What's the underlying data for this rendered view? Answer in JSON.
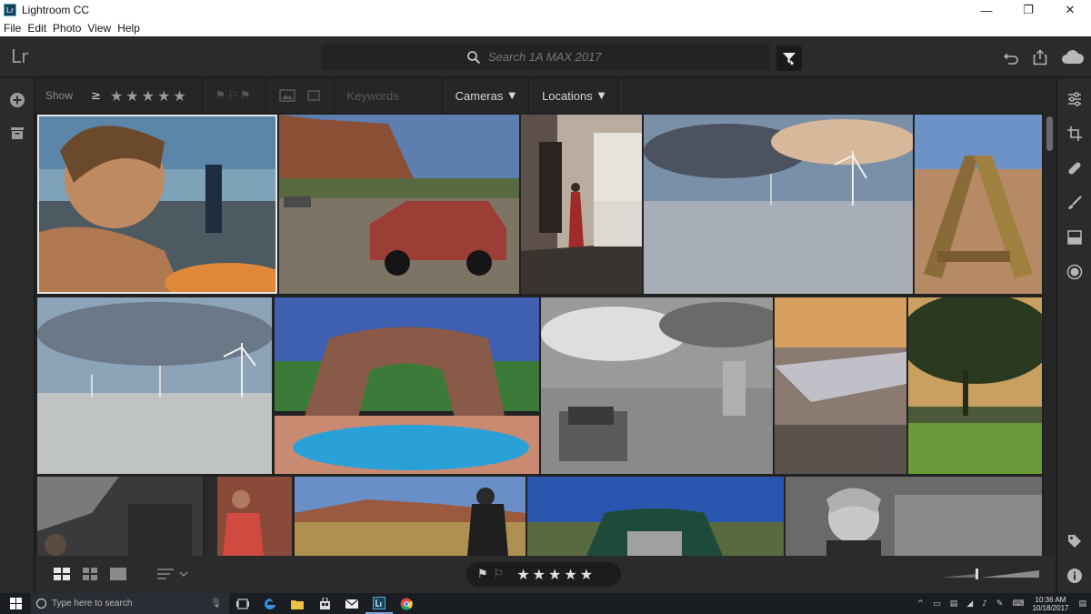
{
  "window": {
    "title": "Lightroom CC",
    "app_icon_text": "Lr",
    "controls": {
      "minimize": "—",
      "maximize": "❐",
      "close": "✕"
    }
  },
  "menu": {
    "items": [
      "File",
      "Edit",
      "Photo",
      "View",
      "Help"
    ]
  },
  "header": {
    "logo": "Lr",
    "search_placeholder": "Search 1A MAX 2017"
  },
  "filterbar": {
    "show_label": "Show",
    "rating_operator": "≥",
    "stars": "★★★★★",
    "flags": "⚑⚐⚑",
    "keywords_placeholder": "Keywords",
    "cameras_label": "Cameras",
    "locations_label": "Locations",
    "chevron": "▼"
  },
  "bottombar": {
    "flag_pick": "⚑",
    "flag_reject": "⚐",
    "stars": "★★★★★"
  },
  "taskbar": {
    "search_placeholder": "Type here to search",
    "mic": "🎙",
    "clock_time": "10:36 AM",
    "clock_date": "10/18/2017",
    "tray": [
      "^",
      "▭",
      "▤",
      "◢",
      "♪",
      "✎",
      "⌨",
      "▤"
    ]
  },
  "colors": {
    "accent": "#4fb0d8",
    "panel": "#2b2b2b",
    "grid_bg": "#222222"
  }
}
